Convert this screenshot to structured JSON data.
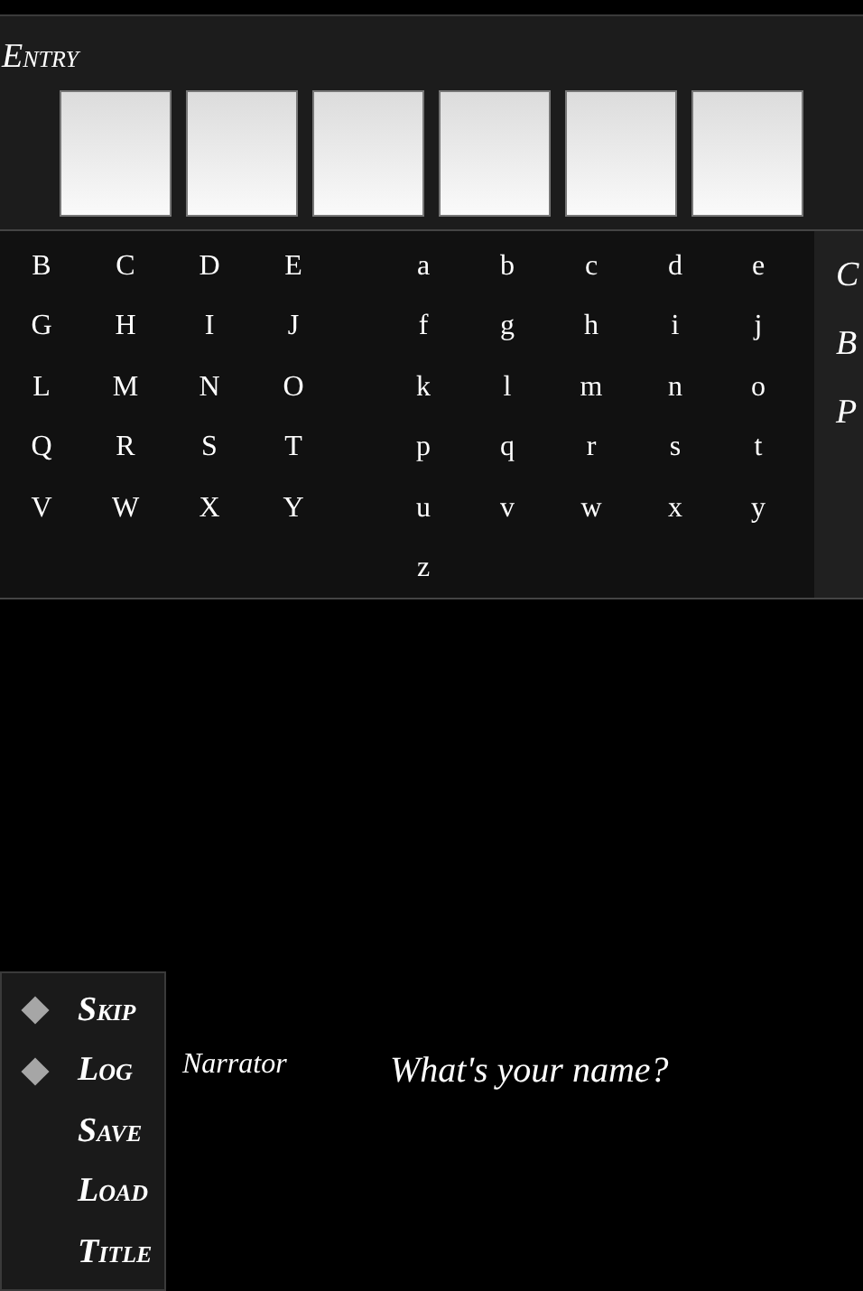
{
  "entry": {
    "label": "Entry"
  },
  "keyboard": {
    "uppercase": [
      [
        "B",
        "C",
        "D",
        "E"
      ],
      [
        "G",
        "H",
        "I",
        "J"
      ],
      [
        "L",
        "M",
        "N",
        "O"
      ],
      [
        "Q",
        "R",
        "S",
        "T"
      ],
      [
        "V",
        "W",
        "X",
        "Y"
      ]
    ],
    "lowercase": [
      [
        "a",
        "b",
        "c",
        "d",
        "e"
      ],
      [
        "f",
        "g",
        "h",
        "i",
        "j"
      ],
      [
        "k",
        "l",
        "m",
        "n",
        "o"
      ],
      [
        "p",
        "q",
        "r",
        "s",
        "t"
      ],
      [
        "u",
        "v",
        "w",
        "x",
        "y"
      ],
      [
        "z"
      ]
    ]
  },
  "side_buttons": [
    "C",
    "B",
    "P"
  ],
  "menu": [
    {
      "label": "Skip",
      "marked": true
    },
    {
      "label": "Log",
      "marked": true
    },
    {
      "label": "Save",
      "marked": false
    },
    {
      "label": "Load",
      "marked": false
    },
    {
      "label": "Title",
      "marked": false
    }
  ],
  "dialogue": {
    "speaker": "Narrator",
    "text": "What's your name?"
  }
}
